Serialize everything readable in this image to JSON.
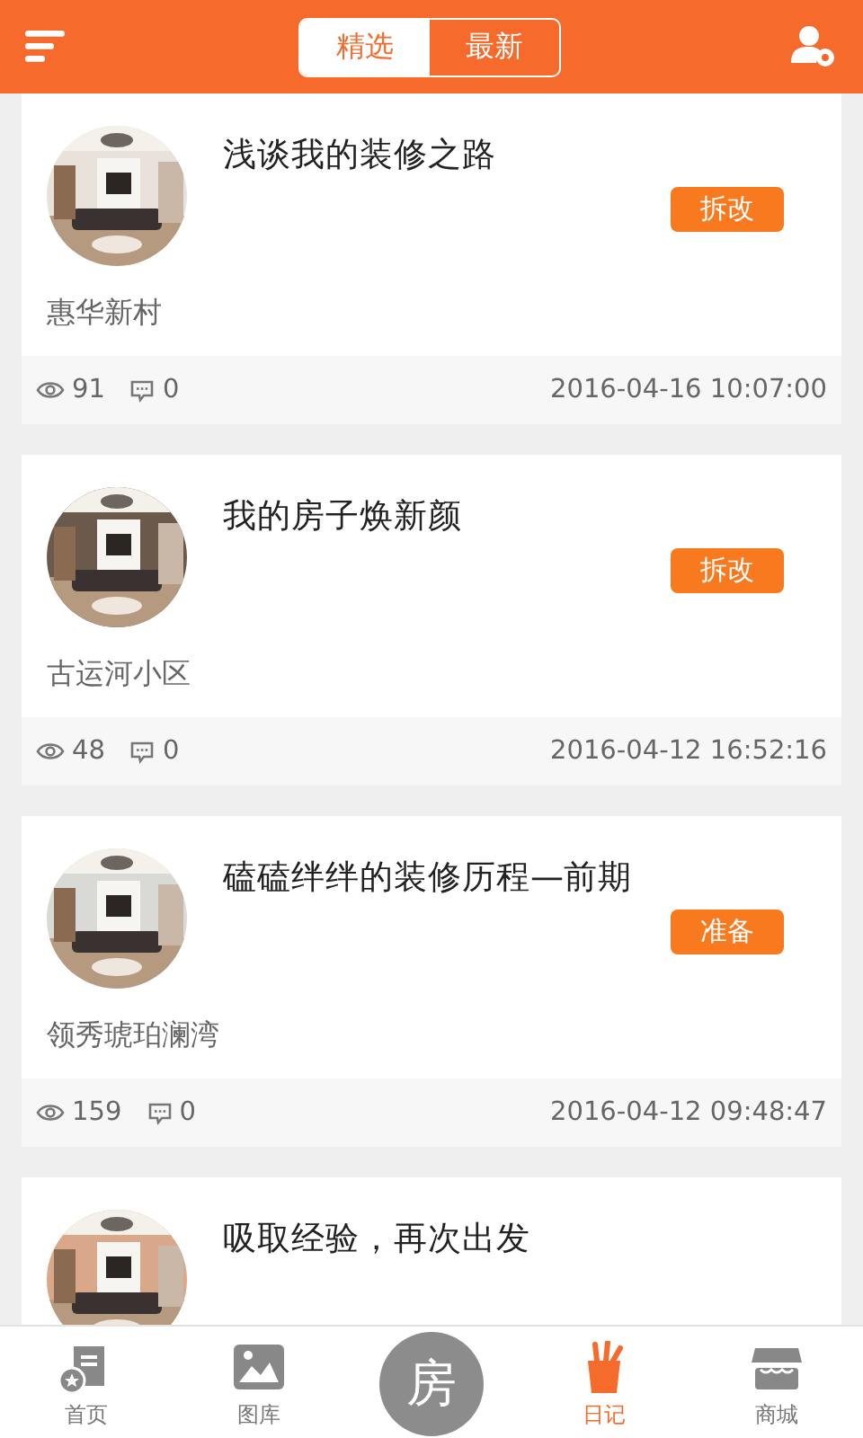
{
  "header": {
    "tabs": [
      {
        "label": "精选",
        "selected": true
      },
      {
        "label": "最新",
        "selected": false
      }
    ]
  },
  "diaries": [
    {
      "title": "浅谈我的装修之路",
      "tag": "拆改",
      "location": "惠华新村",
      "views": "91",
      "comments": "0",
      "date": "2016-04-16 10:07:00"
    },
    {
      "title": "我的房子焕新颜",
      "tag": "拆改",
      "location": "古运河小区",
      "views": "48",
      "comments": "0",
      "date": "2016-04-12 16:52:16"
    },
    {
      "title": "磕磕绊绊的装修历程—前期",
      "tag": "准备",
      "location": "领秀琥珀澜湾",
      "views": "159",
      "comments": "0",
      "date": "2016-04-12 09:48:47"
    },
    {
      "title": "吸取经验，再次出发"
    }
  ],
  "tab_bar": [
    {
      "label": "首页",
      "kind": "home",
      "selected": false
    },
    {
      "label": "图库",
      "kind": "gallery",
      "selected": false
    },
    {
      "label": "房",
      "kind": "center",
      "selected": false
    },
    {
      "label": "日记",
      "kind": "diary",
      "selected": true
    },
    {
      "label": "商城",
      "kind": "shop",
      "selected": false
    }
  ]
}
